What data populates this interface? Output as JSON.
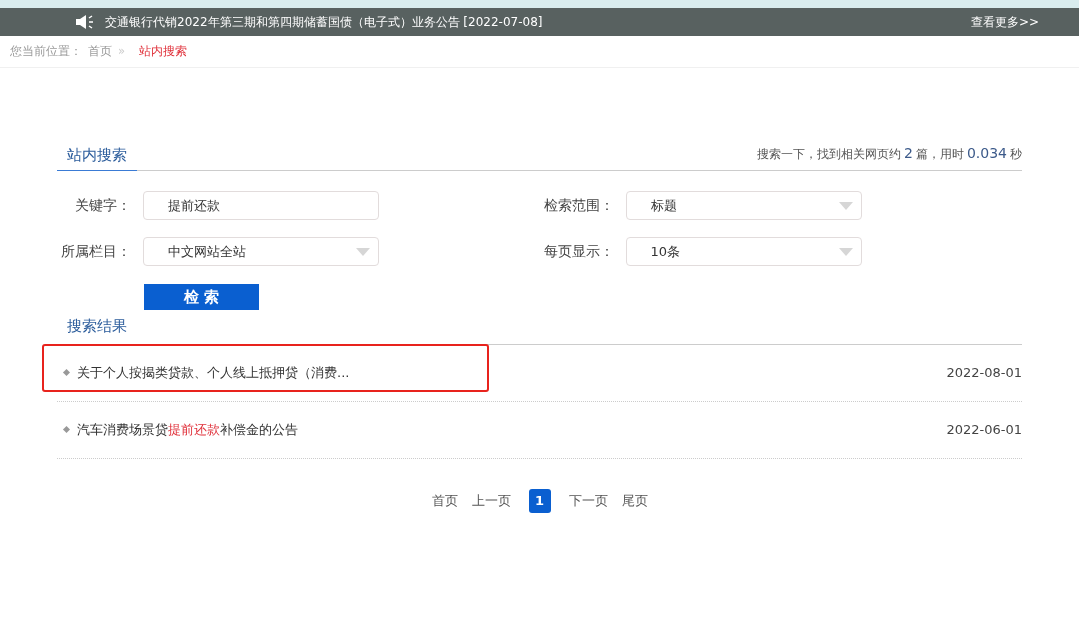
{
  "notice_bar": {
    "text": "交通银行代销2022年第三期和第四期储蓄国债（电子式）业务公告 [2022-07-08]",
    "more_link": "查看更多>>"
  },
  "breadcrumb": {
    "prefix": "您当前位置：",
    "items": [
      {
        "label": "首页",
        "current": false
      },
      {
        "label": "站内搜索",
        "current": true
      }
    ],
    "separator": "»"
  },
  "search_panel": {
    "title": "站内搜索",
    "stats": [
      {
        "kind": "text",
        "text": "搜索一下，找到相关网页约"
      },
      {
        "kind": "number",
        "text": "2"
      },
      {
        "kind": "text",
        "text": "篇，用时"
      },
      {
        "kind": "number",
        "text": "0.034"
      },
      {
        "kind": "text",
        "text": "秒"
      }
    ],
    "fields": [
      {
        "kind": "input",
        "label": "关键字：",
        "value": "提前还款"
      },
      {
        "kind": "select",
        "label": "检索范围：",
        "value": "标题"
      },
      {
        "kind": "select",
        "label": "所属栏目：",
        "value": "中文网站全站"
      },
      {
        "kind": "select",
        "label": "每页显示：",
        "value": "10条"
      }
    ],
    "button": "检 索"
  },
  "results": {
    "title": "搜索结果",
    "items": [
      {
        "outlined": true,
        "date": "2022-08-01",
        "parts": [
          {
            "text": "关于个人按揭类贷款、个人线上抵押贷（消费...",
            "highlight": false
          }
        ]
      },
      {
        "outlined": false,
        "date": "2022-06-01",
        "parts": [
          {
            "text": "汽车消费场景贷",
            "highlight": false
          },
          {
            "text": "提前还款",
            "highlight": true
          },
          {
            "text": "补偿金的公告",
            "highlight": false
          }
        ]
      }
    ]
  },
  "pagination": [
    {
      "label": "首页",
      "selected": false
    },
    {
      "label": "上一页",
      "selected": false
    },
    {
      "label": "1",
      "selected": true
    },
    {
      "label": "下一页",
      "selected": false
    },
    {
      "label": "尾页",
      "selected": false
    }
  ]
}
